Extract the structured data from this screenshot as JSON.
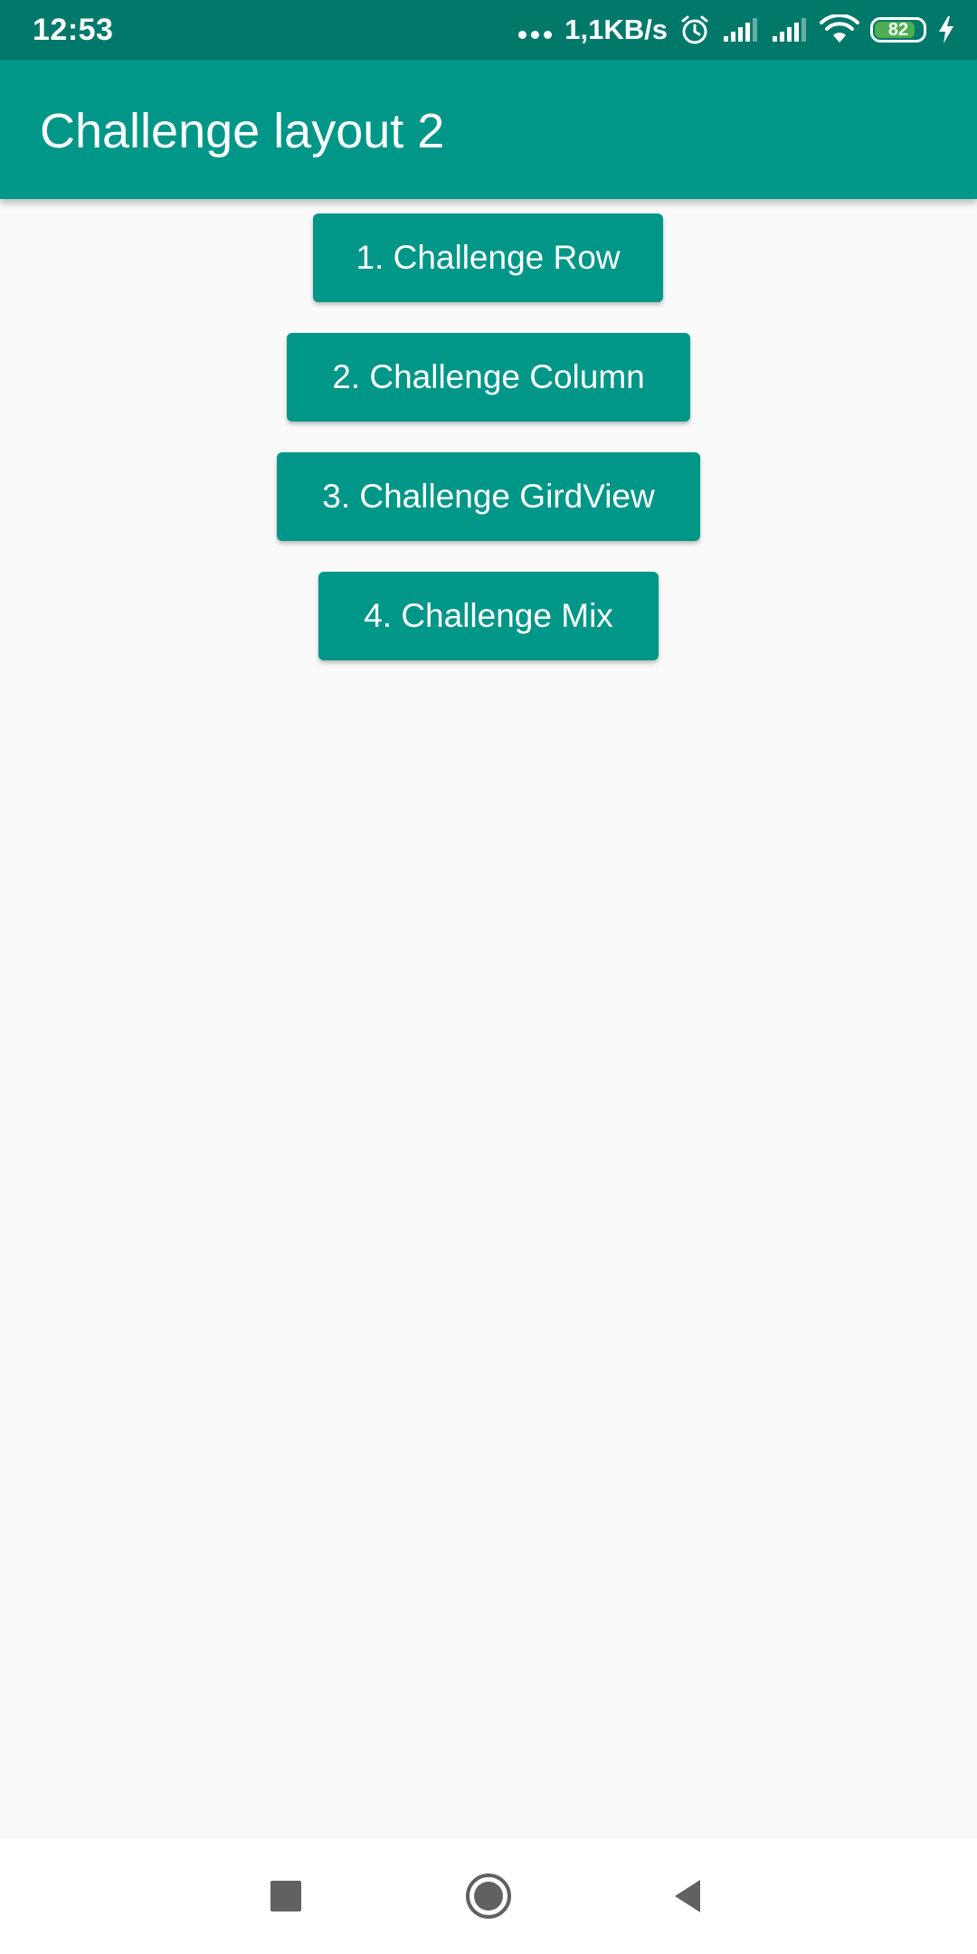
{
  "status_bar": {
    "time": "12:53",
    "net_speed": "1,1KB/s",
    "battery_level": "82",
    "icons": [
      "more-dots-icon",
      "alarm-icon",
      "signal-icon",
      "signal-icon",
      "wifi-icon",
      "battery-icon",
      "charging-icon"
    ],
    "battery_color": "#4caf50"
  },
  "app_bar": {
    "title": "Challenge layout 2",
    "color": "#009688"
  },
  "buttons": [
    {
      "label": "1. Challenge Row"
    },
    {
      "label": "2. Challenge Column"
    },
    {
      "label": "3. Challenge GirdView"
    },
    {
      "label": "4. Challenge Mix"
    }
  ],
  "nav_bar": {
    "icons": [
      "recents-square-icon",
      "home-circle-icon",
      "back-triangle-icon"
    ]
  },
  "colors": {
    "primary": "#009688",
    "primary_dark": "#00796b",
    "background": "#fafafa"
  }
}
